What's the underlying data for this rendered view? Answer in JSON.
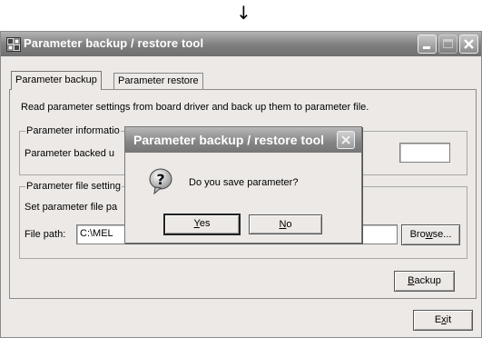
{
  "arrow_glyph": "↓",
  "window": {
    "title": "Parameter backup / restore tool",
    "tabs": [
      {
        "label": "Parameter backup",
        "active": true
      },
      {
        "label": "Parameter restore",
        "active": false
      }
    ],
    "description": "Read parameter settings from board driver and back up them to parameter file.",
    "group_info": {
      "label": "Parameter informatio",
      "text": "Parameter backed u"
    },
    "group_file": {
      "label": "Parameter file setting",
      "set_text": "Set parameter file pa",
      "file_path_label": "File path:",
      "file_path_value": "C:\\MEL"
    },
    "browse_button": {
      "pre": "Bro",
      "accel": "w",
      "post": "se..."
    },
    "backup_button": {
      "pre": "",
      "accel": "B",
      "post": "ackup"
    },
    "exit_button": {
      "pre": "E",
      "accel": "x",
      "post": "it"
    }
  },
  "dialog": {
    "title": "Parameter backup / restore tool",
    "icon": "question-icon",
    "message": "Do you save parameter?",
    "yes_button": {
      "pre": "",
      "accel": "Y",
      "post": "es"
    },
    "no_button": {
      "pre": "",
      "accel": "N",
      "post": "o"
    }
  },
  "colors": {
    "titlebar": "#7e7e7e",
    "face": "#ece9e6",
    "title_text": "#ffffff"
  }
}
